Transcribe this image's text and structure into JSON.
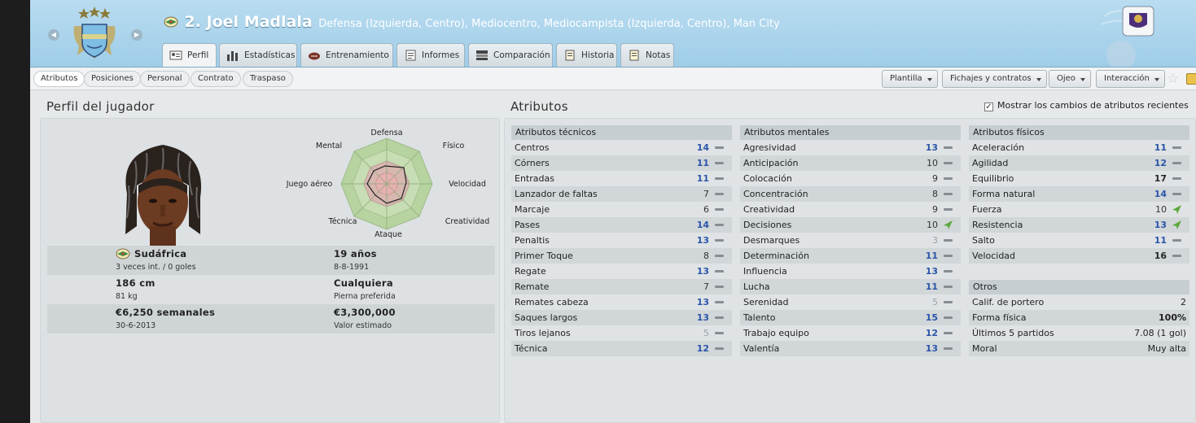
{
  "header": {
    "number_name": "2. Joel Madlala",
    "description": "Defensa (Izquierda, Centro), Mediocentro, Mediocampista (Izquierda, Centro), Man City",
    "nav_prev": "◀",
    "nav_next": "▶"
  },
  "tabs": [
    {
      "label": "Perfil",
      "icon": "profile-card-icon",
      "active": true
    },
    {
      "label": "Estadísticas",
      "icon": "stats-bars-icon"
    },
    {
      "label": "Entrenamiento",
      "icon": "training-ball-icon"
    },
    {
      "label": "Informes",
      "icon": "report-icon"
    },
    {
      "label": "Comparación",
      "icon": "comparison-icon"
    },
    {
      "label": "Historia",
      "icon": "history-book-icon"
    },
    {
      "label": "Notas",
      "icon": "notes-icon"
    }
  ],
  "subtabs": [
    "Atributos",
    "Posiciones",
    "Personal",
    "Contrato",
    "Traspaso"
  ],
  "toolbar": {
    "dropdowns": [
      "Plantilla",
      "Fichajes y contratos",
      "Ojeo",
      "Interacción"
    ]
  },
  "profile": {
    "title": "Perfil del jugador",
    "nationality": "Sudáfrica",
    "caps": "3 veces int. / 0 goles",
    "age": "19 años",
    "dob": "8-8-1991",
    "height": "186 cm",
    "weight": "81 kg",
    "foot": "Cualquiera",
    "foot_label": "Pierna preferida",
    "wage": "€6,250 semanales",
    "contract_end": "30-6-2013",
    "value": "€3,300,000",
    "value_label": "Valor estimado"
  },
  "radar": {
    "labels": [
      "Defensa",
      "Físico",
      "Velocidad",
      "Creatividad",
      "Ataque",
      "Técnica",
      "Juego aéreo",
      "Mental"
    ]
  },
  "attributes": {
    "title": "Atributos",
    "show_changes_label": "Mostrar los cambios de atributos recientes",
    "show_changes_checked": true,
    "technical": {
      "title": "Atributos técnicos",
      "items": [
        {
          "name": "Centros",
          "value": 14,
          "trend": "flat"
        },
        {
          "name": "Córners",
          "value": 11,
          "trend": "flat"
        },
        {
          "name": "Entradas",
          "value": 11,
          "trend": "flat"
        },
        {
          "name": "Lanzador de faltas",
          "value": 7,
          "trend": "flat"
        },
        {
          "name": "Marcaje",
          "value": 6,
          "trend": "flat"
        },
        {
          "name": "Pases",
          "value": 14,
          "trend": "flat"
        },
        {
          "name": "Penaltis",
          "value": 13,
          "trend": "flat"
        },
        {
          "name": "Primer Toque",
          "value": 8,
          "trend": "flat"
        },
        {
          "name": "Regate",
          "value": 13,
          "trend": "flat"
        },
        {
          "name": "Remate",
          "value": 7,
          "trend": "flat"
        },
        {
          "name": "Remates cabeza",
          "value": 13,
          "trend": "flat"
        },
        {
          "name": "Saques largos",
          "value": 13,
          "trend": "flat"
        },
        {
          "name": "Tiros lejanos",
          "value": 5,
          "trend": "flat"
        },
        {
          "name": "Técnica",
          "value": 12,
          "trend": "flat"
        }
      ]
    },
    "mental": {
      "title": "Atributos mentales",
      "items": [
        {
          "name": "Agresividad",
          "value": 13,
          "trend": "flat"
        },
        {
          "name": "Anticipación",
          "value": 10,
          "trend": "flat"
        },
        {
          "name": "Colocación",
          "value": 9,
          "trend": "flat"
        },
        {
          "name": "Concentración",
          "value": 8,
          "trend": "flat"
        },
        {
          "name": "Creatividad",
          "value": 9,
          "trend": "flat"
        },
        {
          "name": "Decisiones",
          "value": 10,
          "trend": "up"
        },
        {
          "name": "Desmarques",
          "value": 3,
          "trend": "flat"
        },
        {
          "name": "Determinación",
          "value": 11,
          "trend": "flat"
        },
        {
          "name": "Influencia",
          "value": 13,
          "trend": "flat"
        },
        {
          "name": "Lucha",
          "value": 11,
          "trend": "flat"
        },
        {
          "name": "Serenidad",
          "value": 5,
          "trend": "flat"
        },
        {
          "name": "Talento",
          "value": 15,
          "trend": "flat"
        },
        {
          "name": "Trabajo equipo",
          "value": 12,
          "trend": "flat"
        },
        {
          "name": "Valentía",
          "value": 13,
          "trend": "flat"
        }
      ]
    },
    "physical": {
      "title": "Atributos físicos",
      "items": [
        {
          "name": "Aceleración",
          "value": 11,
          "trend": "flat"
        },
        {
          "name": "Agilidad",
          "value": 12,
          "trend": "flat"
        },
        {
          "name": "Equilibrio",
          "value": 17,
          "trend": "flat"
        },
        {
          "name": "Forma natural",
          "value": 14,
          "trend": "flat"
        },
        {
          "name": "Fuerza",
          "value": 10,
          "trend": "up"
        },
        {
          "name": "Resistencia",
          "value": 13,
          "trend": "up"
        },
        {
          "name": "Salto",
          "value": 11,
          "trend": "flat"
        },
        {
          "name": "Velocidad",
          "value": 16,
          "trend": "flat"
        }
      ]
    },
    "others": {
      "title": "Otros",
      "items": [
        {
          "name": "Calif. de portero",
          "value": "2",
          "bold": false
        },
        {
          "name": "Forma física",
          "value": "100%",
          "bold": true
        },
        {
          "name": "Últimos 5 partidos",
          "value": "7.08 (1 gol)",
          "bold": false
        },
        {
          "name": "Moral",
          "value": "Muy alta",
          "bold": false
        }
      ]
    }
  },
  "colors": {
    "header_bg": "#a9d4ec",
    "value_blue": "#2a55a8",
    "trend_up": "#5aa83c",
    "trend_flat": "#868d92"
  }
}
